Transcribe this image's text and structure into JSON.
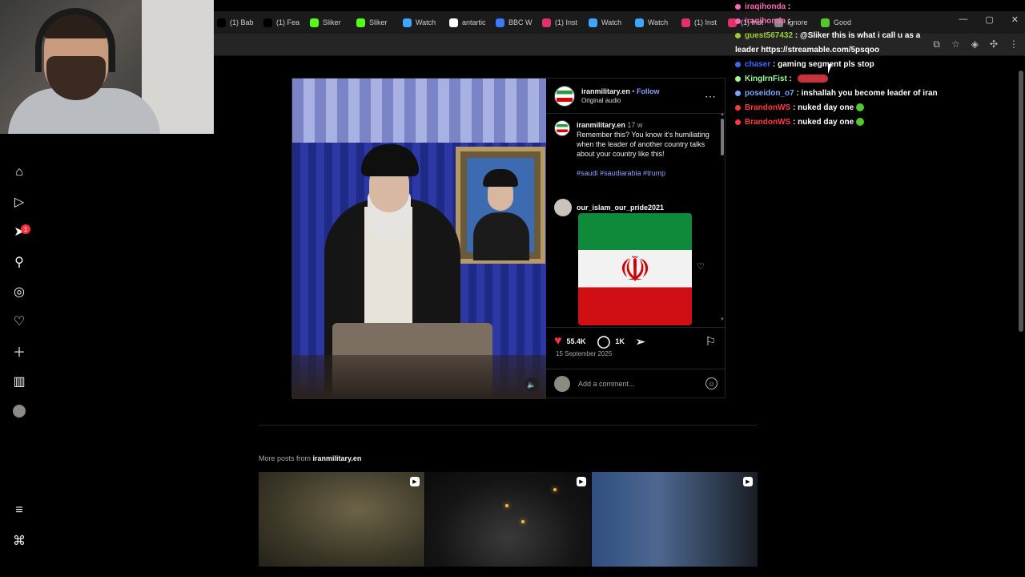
{
  "browser": {
    "tabs": [
      {
        "label": "(1) Bab",
        "color": "#000000"
      },
      {
        "label": "(1) Fea",
        "color": "#000000"
      },
      {
        "label": "Sliker",
        "color": "#53fc18"
      },
      {
        "label": "Sliker",
        "color": "#53fc18"
      },
      {
        "label": "Watch",
        "color": "#3ea6ff"
      },
      {
        "label": "antartic",
        "color": "#ffffff"
      },
      {
        "label": "BBC W",
        "color": "#3b78ff"
      },
      {
        "label": "(1) Inst",
        "color": "#e1306c"
      },
      {
        "label": "Watch",
        "color": "#3ea6ff"
      },
      {
        "label": "Watch",
        "color": "#3ea6ff"
      },
      {
        "label": "(1) Inst",
        "color": "#e1306c"
      },
      {
        "label": "(1) Inst",
        "color": "#e1306c"
      },
      {
        "label": "Ignore",
        "color": "#888888"
      },
      {
        "label": "Good",
        "color": "#53c72b"
      }
    ]
  },
  "chat": [
    {
      "user": "iraqihonda",
      "text": "",
      "color": "#ff69b4"
    },
    {
      "user": "iraqihonda",
      "text": "",
      "color": "#ff69b4"
    },
    {
      "user": "guest567432",
      "text": "@Sliker this is what i call u as a leader https://streamable.com/5psqoo",
      "color": "#9acd32"
    },
    {
      "user": "chaser",
      "text": "gaming segment pls stop",
      "color": "#3b6bff"
    },
    {
      "user": "KingIrnFist",
      "text": "",
      "color": "#9aff9a"
    },
    {
      "user": "poseidon_o7",
      "text": "inshallah you become leader of iran",
      "color": "#7aa7ff"
    },
    {
      "user": "BrandonWS",
      "text": "nuked day one",
      "color": "#ff3b3b"
    },
    {
      "user": "BrandonWS",
      "text": "nuked day one",
      "color": "#ff3b3b"
    }
  ],
  "post": {
    "username": "iranmilitary.en",
    "follow_label": "Follow",
    "audio": "Original audio",
    "caption_time": "17 w",
    "caption": "Remember this? You know it's humiliating when the leader of another country talks about your country like this!",
    "hashtags": "#saudi #saudiarabia #trump",
    "comment_user": "our_islam_our_pride2021",
    "likes": "55.4K",
    "comments": "1K",
    "date": "15 September 2025",
    "add_comment_placeholder": "Add a comment...",
    "notification_count": "1"
  },
  "more_posts": {
    "prefix": "More posts from",
    "username": "iranmilitary.en"
  }
}
